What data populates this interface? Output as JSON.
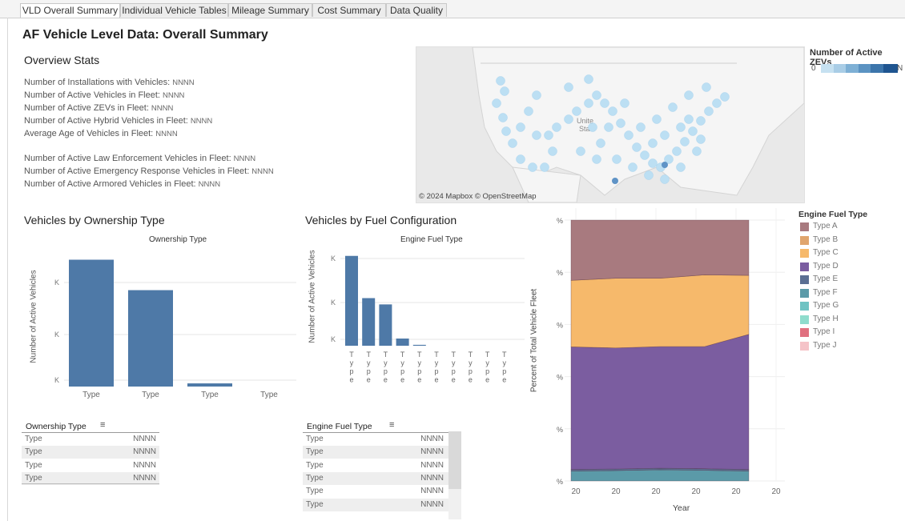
{
  "tabs": [
    {
      "label": "VLD Overall Summary",
      "active": true
    },
    {
      "label": "Individual Vehicle Tables",
      "active": false
    },
    {
      "label": "Mileage Summary",
      "active": false
    },
    {
      "label": "Cost Summary",
      "active": false
    },
    {
      "label": "Data Quality",
      "active": false
    }
  ],
  "page_title": "AF Vehicle Level Data: Overall Summary",
  "overview": {
    "heading": "Overview Stats",
    "stats": [
      {
        "label": "Number of Installations with Vehicles:",
        "value": "NNNN"
      },
      {
        "label": "Number of Active Vehicles in Fleet:",
        "value": "NNNN"
      },
      {
        "label": "Number of Active ZEVs in Fleet:",
        "value": "NNNN"
      },
      {
        "label": "Number of Active Hybrid Vehicles in Fleet:",
        "value": "NNNN"
      },
      {
        "label": "Average Age of Vehicles in Fleet:",
        "value": "NNNN"
      },
      {
        "label": "Number of Active Law Enforcement Vehicles in Fleet:",
        "value": "NNNN"
      },
      {
        "label": "Number of Active Emergency Response Vehicles in Fleet:",
        "value": "NNNN"
      },
      {
        "label": "Number of Active Armored Vehicles in Fleet:",
        "value": "NNNN"
      }
    ]
  },
  "map": {
    "label": "Unite\nState",
    "attribution": "© 2024 Mapbox © OpenStreetMap",
    "legend_title": "Number of Active ZEVs",
    "legend_min": "0",
    "legend_max": "N",
    "legend_colors": [
      "#c6e1f1",
      "#a9cde6",
      "#7eb0d5",
      "#5b93c2",
      "#3c75ab",
      "#1f5590"
    ]
  },
  "ownership": {
    "heading": "Vehicles by Ownership Type",
    "ylabel": "Number of Active Vehicles",
    "table_header": "Ownership Type",
    "table_rows": [
      {
        "type": "Type",
        "value": "NNNN"
      },
      {
        "type": "Type",
        "value": "NNNN"
      },
      {
        "type": "Type",
        "value": "NNNN"
      },
      {
        "type": "Type",
        "value": "NNNN"
      }
    ]
  },
  "fuel": {
    "heading": "Vehicles by Fuel Configuration",
    "ylabel": "Number of Active Vehicles",
    "table_header": "Engine Fuel Type",
    "table_rows": [
      {
        "type": "Type",
        "value": "NNNN"
      },
      {
        "type": "Type",
        "value": "NNNN"
      },
      {
        "type": "Type",
        "value": "NNNN"
      },
      {
        "type": "Type",
        "value": "NNNN"
      },
      {
        "type": "Type",
        "value": "NNNN"
      },
      {
        "type": "Type",
        "value": "NNNN"
      }
    ]
  },
  "area": {
    "ylabel": "Percent of Total Vehicle Fleet",
    "xlabel": "Year",
    "legend_title": "Engine Fuel Type",
    "legend": [
      {
        "name": "Type A",
        "color": "#a87a7f"
      },
      {
        "name": "Type B",
        "color": "#e0a56d"
      },
      {
        "name": "Type C",
        "color": "#f6b96b"
      },
      {
        "name": "Type D",
        "color": "#7b5da0"
      },
      {
        "name": "Type E",
        "color": "#5b6f93"
      },
      {
        "name": "Type F",
        "color": "#5b9aa8"
      },
      {
        "name": "Type G",
        "color": "#6fc3c3"
      },
      {
        "name": "Type H",
        "color": "#8fdccd"
      },
      {
        "name": "Type I",
        "color": "#e0707f"
      },
      {
        "name": "Type J",
        "color": "#f5c3c8"
      }
    ]
  },
  "chart_data": [
    {
      "type": "bar",
      "title": "Ownership Type",
      "ylabel": "Number of Active Vehicles",
      "categories": [
        "Type",
        "Type",
        "Type",
        "Type"
      ],
      "values": [
        100,
        76,
        2.5,
        0
      ],
      "ylim": [
        0,
        106
      ],
      "yticks": [
        "K",
        "K",
        "K"
      ]
    },
    {
      "type": "bar",
      "title": "Engine Fuel Type",
      "ylabel": "Number of Active Vehicles",
      "categories": [
        "Type",
        "Type",
        "Type",
        "Type",
        "Type",
        "Type",
        "Type",
        "Type",
        "Type",
        "Type"
      ],
      "values": [
        100,
        53,
        46,
        8,
        1,
        0,
        0,
        0,
        0,
        0
      ],
      "ylim": [
        0,
        106
      ],
      "yticks": [
        "K",
        "K",
        "K"
      ]
    },
    {
      "type": "area",
      "ylabel": "Percent of Total Vehicle Fleet",
      "xlabel": "Year",
      "x": [
        "20",
        "20",
        "20",
        "20",
        "20",
        "20"
      ],
      "yticks": [
        "%",
        "%",
        "%",
        "%",
        "%",
        "%"
      ],
      "ylim": [
        0,
        100
      ],
      "series": [
        {
          "name": "Type F",
          "values": [
            3.8,
            4.0,
            4.3,
            4.1,
            3.8
          ]
        },
        {
          "name": "Type E",
          "values": [
            0.6,
            0.6,
            0.6,
            0.6,
            0.6
          ]
        },
        {
          "name": "Type D",
          "values": [
            47.0,
            46.4,
            46.6,
            46.8,
            51.8
          ]
        },
        {
          "name": "Type C",
          "values": [
            25.5,
            26.7,
            26.2,
            27.5,
            22.6
          ]
        },
        {
          "name": "Type A",
          "values": [
            23.1,
            22.3,
            22.3,
            21.0,
            21.2
          ]
        }
      ]
    }
  ]
}
